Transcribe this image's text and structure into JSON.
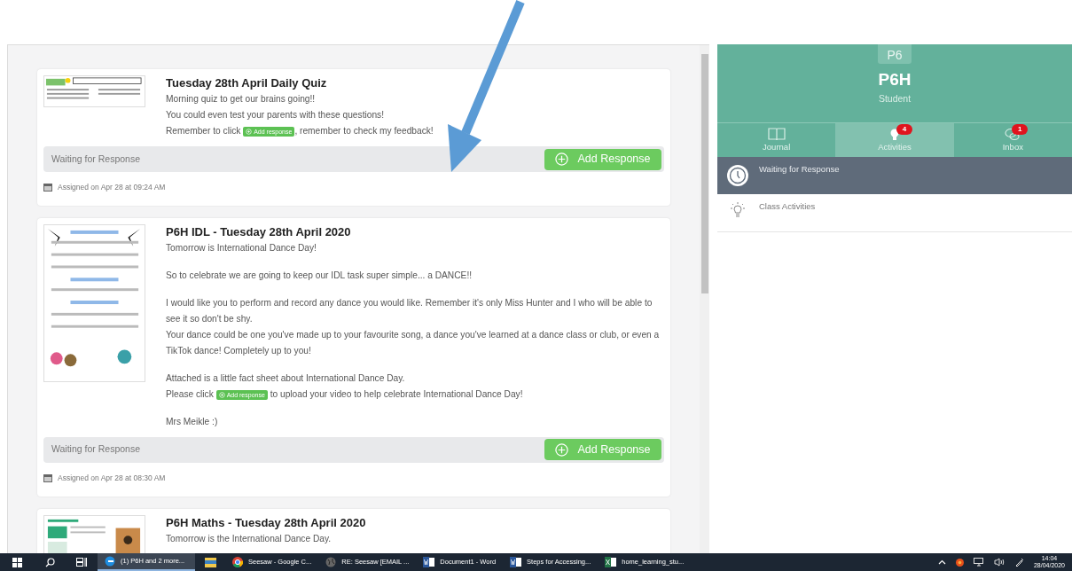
{
  "cards": [
    {
      "title": "Tuesday 28th April Daily Quiz",
      "paragraphs": [
        [
          [
            {
              "kind": "text",
              "text": "Morning quiz to get our brains going!!"
            }
          ],
          [
            {
              "kind": "text",
              "text": "You could even test your parents with these questions!"
            }
          ],
          [
            {
              "kind": "text",
              "text": "Remember to click "
            },
            {
              "kind": "chip",
              "text": "Add response"
            },
            {
              "kind": "text",
              "text": ", remember to check my feedback!"
            }
          ]
        ]
      ],
      "status": "Waiting for Response",
      "button": "Add Response",
      "assigned": "Assigned on Apr 28 at 09:24 AM"
    },
    {
      "title": "P6H IDL - Tuesday 28th April 2020",
      "paragraphs": [
        [
          [
            {
              "kind": "text",
              "text": "Tomorrow is International Dance Day!"
            }
          ]
        ],
        [
          [
            {
              "kind": "text",
              "text": "So to celebrate we are going to keep our IDL task super simple... a DANCE!!"
            }
          ]
        ],
        [
          [
            {
              "kind": "text",
              "text": "I would like you to perform and record any dance you would like. Remember it's only Miss Hunter and I who will be able to see it so don't be shy."
            }
          ],
          [
            {
              "kind": "text",
              "text": "Your dance could be one you've made up to your favourite song, a dance you've learned at a dance class or club, or even a TikTok dance! Completely up to you!"
            }
          ]
        ],
        [
          [
            {
              "kind": "text",
              "text": "Attached is a little fact sheet about International Dance Day."
            }
          ],
          [
            {
              "kind": "text",
              "text": "Please click "
            },
            {
              "kind": "chip",
              "text": "Add response"
            },
            {
              "kind": "text",
              "text": " to upload your video to help celebrate International Dance Day!"
            }
          ]
        ],
        [
          [
            {
              "kind": "text",
              "text": "Mrs Meikle :)"
            }
          ]
        ]
      ],
      "status": "Waiting for Response",
      "button": "Add Response",
      "assigned": "Assigned on Apr 28 at 08:30 AM"
    },
    {
      "title": "P6H Maths - Tuesday 28th April 2020",
      "paragraphs": [
        [
          [
            {
              "kind": "text",
              "text": "Tomorrow is the International Dance Day."
            }
          ]
        ]
      ]
    }
  ],
  "profile": {
    "avatar": "P6",
    "name": "P6H",
    "role": "Student"
  },
  "tabs": [
    {
      "label": "Journal",
      "selected": false
    },
    {
      "label": "Activities",
      "selected": true,
      "badge": "4"
    },
    {
      "label": "Inbox",
      "selected": false,
      "badge": "1"
    }
  ],
  "filters": [
    {
      "label": "Waiting for Response",
      "selected": true
    },
    {
      "label": "Class Activities",
      "selected": false
    }
  ],
  "taskbar": {
    "apps": [
      {
        "label": "(1) P6H and 2 more...",
        "selected": true
      },
      {
        "selected": false
      },
      {
        "label": "Seesaw - Google C...",
        "selected": false
      },
      {
        "label": "RE: Seesaw [EMAIL ...",
        "selected": false
      },
      {
        "label": "Document1 - Word",
        "selected": false
      },
      {
        "label": "Steps for Accessing...",
        "selected": false
      },
      {
        "label": "home_learning_stu...",
        "selected": false
      }
    ],
    "time": "14:04",
    "date": "28/04/2020"
  }
}
